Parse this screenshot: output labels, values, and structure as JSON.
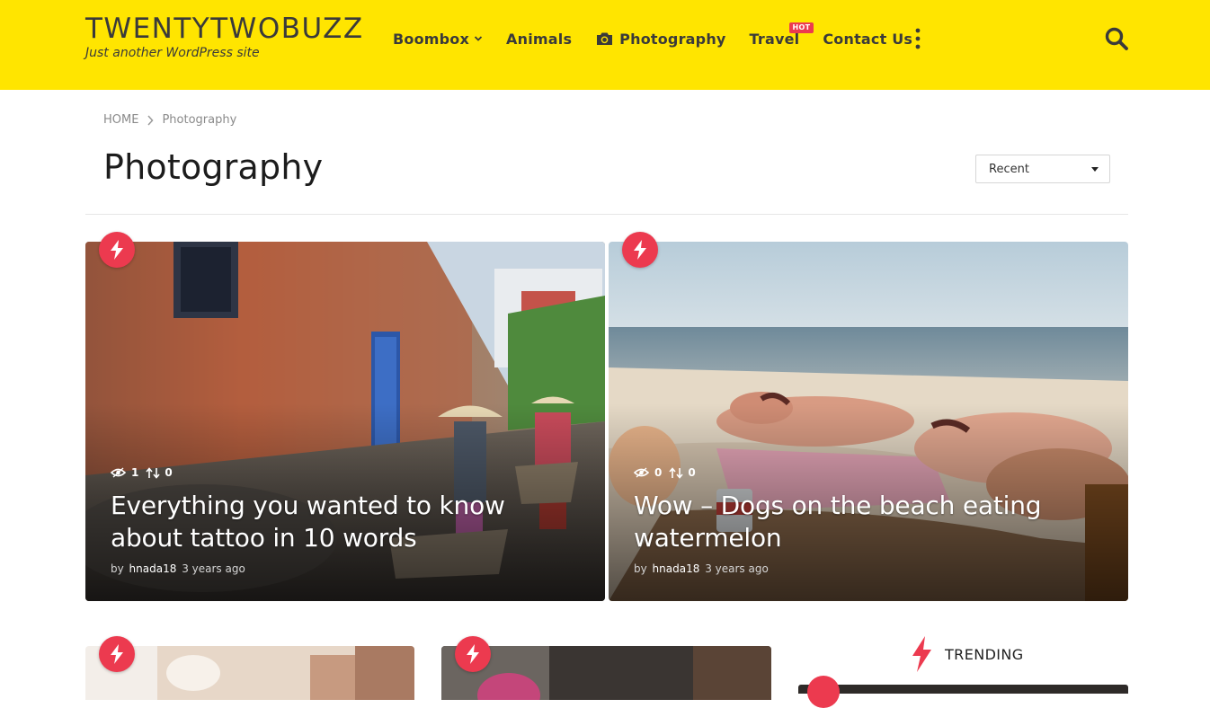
{
  "site": {
    "title": "TWENTYTWOBUZZ",
    "tagline": "Just another WordPress site"
  },
  "nav": {
    "items": [
      {
        "label": "Boombox",
        "has_dropdown": true
      },
      {
        "label": "Animals"
      },
      {
        "label": "Photography",
        "icon": "camera-icon"
      },
      {
        "label": "Travel",
        "badge": "HOT"
      },
      {
        "label": "Contact Us"
      }
    ],
    "more_icon": "vertical-dots-icon",
    "search_icon": "search-icon"
  },
  "breadcrumb": {
    "home": "HOME",
    "current": "Photography"
  },
  "page": {
    "title": "Photography"
  },
  "sort": {
    "selected": "Recent"
  },
  "posts": [
    {
      "title": "Everything you wanted to know about tattoo in 10 words",
      "views": "1",
      "shares": "0",
      "by": "by",
      "author": "hnada18",
      "time": "3 years ago"
    },
    {
      "title": "Wow – Dogs on the beach eating watermelon",
      "views": "0",
      "shares": "0",
      "by": "by",
      "author": "hnada18",
      "time": "3 years ago"
    }
  ],
  "trending": {
    "label": "TRENDING"
  },
  "colors": {
    "header_bg": "#ffe500",
    "accent": "#ec3a4f",
    "text_dark": "#3a3a3a"
  }
}
